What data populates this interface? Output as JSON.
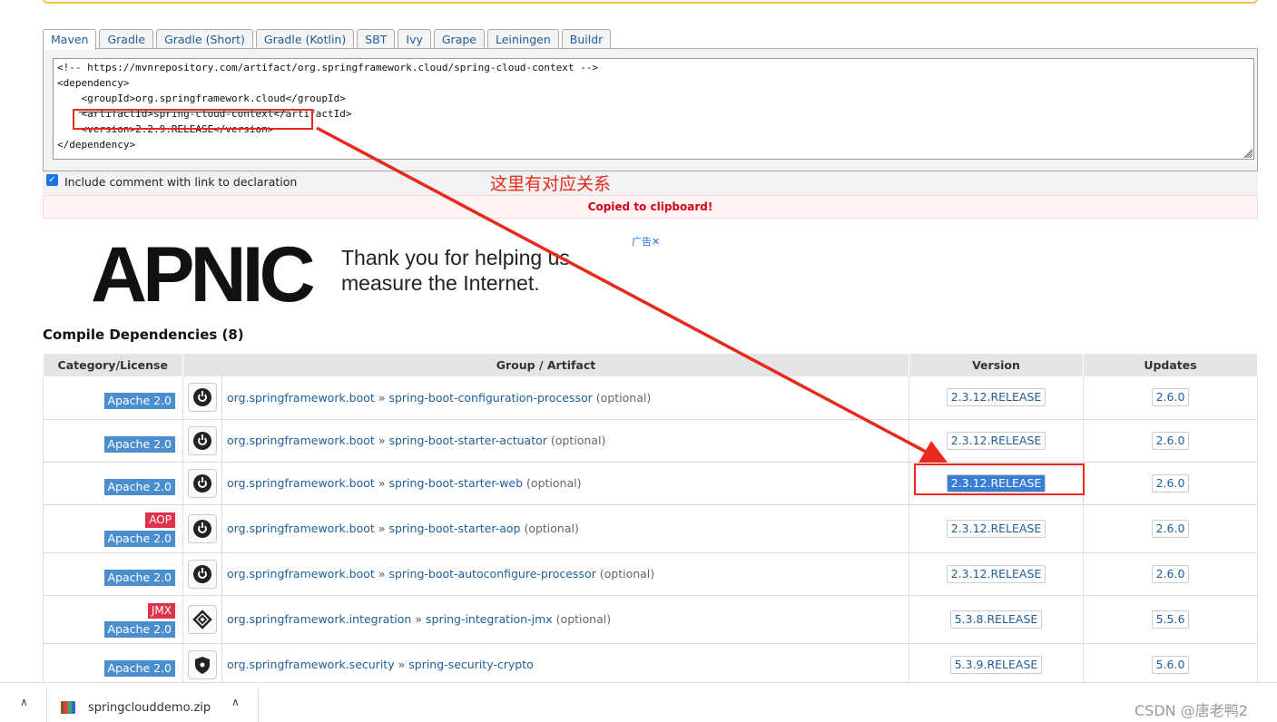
{
  "tabs": [
    "Maven",
    "Gradle",
    "Gradle (Short)",
    "Gradle (Kotlin)",
    "SBT",
    "Ivy",
    "Grape",
    "Leiningen",
    "Buildr"
  ],
  "snippet_lines": [
    "<!-- https://mvnrepository.com/artifact/org.springframework.cloud/spring-cloud-context -->",
    "<dependency>",
    "    <groupId>org.springframework.cloud</groupId>",
    "    <artifactId>spring-cloud-context</artifactId>",
    "    <version>2.2.9.RELEASE</version>",
    "</dependency>"
  ],
  "include_comment_label": "Include comment with link to declaration",
  "copied_message": "Copied to clipboard!",
  "annotation_text": "这里有对应关系",
  "ad": {
    "logo": "APNIC",
    "text_line1": "Thank you for helping us",
    "text_line2": "measure the Internet.",
    "badge": "广告✕"
  },
  "section_title": "Compile Dependencies (8)",
  "table": {
    "headers": {
      "category": "Category/License",
      "group_artifact": "Group / Artifact",
      "version": "Version",
      "updates": "Updates"
    },
    "separator": "»",
    "rows": [
      {
        "tags": [],
        "license": "Apache 2.0",
        "icon": "spring-power-icon",
        "group": "org.springframework.boot",
        "artifact": "spring-boot-configuration-processor",
        "note": "(optional)",
        "version": "2.3.12.RELEASE",
        "update": "2.6.0"
      },
      {
        "tags": [],
        "license": "Apache 2.0",
        "icon": "spring-power-icon",
        "group": "org.springframework.boot",
        "artifact": "spring-boot-starter-actuator",
        "note": "(optional)",
        "version": "2.3.12.RELEASE",
        "update": "2.6.0"
      },
      {
        "tags": [],
        "license": "Apache 2.0",
        "icon": "spring-power-icon",
        "group": "org.springframework.boot",
        "artifact": "spring-boot-starter-web",
        "note": "(optional)",
        "version": "2.3.12.RELEASE",
        "update": "2.6.0",
        "selected": true
      },
      {
        "tags": [
          "AOP"
        ],
        "license": "Apache 2.0",
        "icon": "spring-power-icon",
        "group": "org.springframework.boot",
        "artifact": "spring-boot-starter-aop",
        "note": "(optional)",
        "version": "2.3.12.RELEASE",
        "update": "2.6.0"
      },
      {
        "tags": [],
        "license": "Apache 2.0",
        "icon": "spring-power-icon",
        "group": "org.springframework.boot",
        "artifact": "spring-boot-autoconfigure-processor",
        "note": "(optional)",
        "version": "2.3.12.RELEASE",
        "update": "2.6.0"
      },
      {
        "tags": [
          "JMX"
        ],
        "license": "Apache 2.0",
        "icon": "spring-integration-icon",
        "group": "org.springframework.integration",
        "artifact": "spring-integration-jmx",
        "note": "(optional)",
        "version": "5.3.8.RELEASE",
        "update": "5.5.6"
      },
      {
        "tags": [],
        "license": "Apache 2.0",
        "icon": "spring-security-icon",
        "group": "org.springframework.security",
        "artifact": "spring-security-crypto",
        "note": "",
        "version": "5.3.9.RELEASE",
        "update": "5.6.0"
      }
    ]
  },
  "download_bar": {
    "file_name": "springclouddemo.zip",
    "watermark": "CSDN @唐老鸭2"
  },
  "colors": {
    "link": "#1f5e9a",
    "license_badge": "#4a8ed0",
    "tag_badge": "#e0334a",
    "annotation_red": "#e8291c",
    "selected_version": "#3b7ed6"
  }
}
